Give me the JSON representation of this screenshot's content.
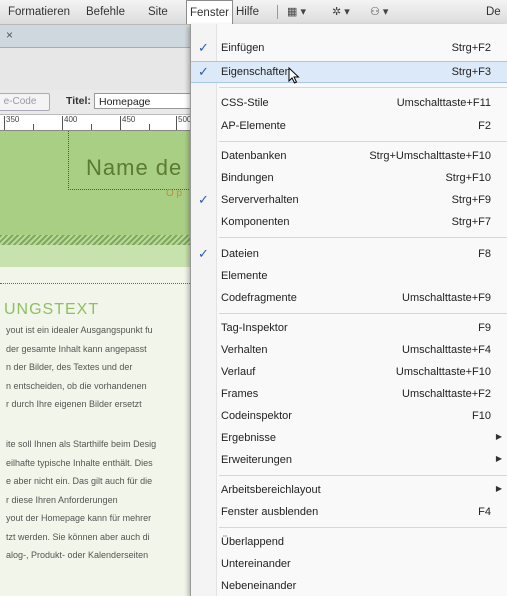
{
  "menubar": {
    "items": [
      "Formatieren",
      "Befehle",
      "Site",
      "Fenster",
      "Hilfe"
    ],
    "active": "Fenster",
    "right_label": "De"
  },
  "editor": {
    "close_glyph": "×",
    "code_button": "e-Code",
    "title_label": "Titel:",
    "title_value": "Homepage",
    "ruler_numbers": [
      "350",
      "400",
      "450",
      "500"
    ],
    "site_name": "Name de",
    "tagline": "O p",
    "heading": "UNGSTEXT",
    "body_lines_1": [
      "yout ist ein idealer Ausgangspunkt fu",
      "der gesamte Inhalt kann angepasst",
      "n der Bilder, des Textes und der",
      "n entscheiden, ob die vorhandenen",
      "r durch Ihre eigenen Bilder ersetzt"
    ],
    "body_lines_2": [
      "ite soll Ihnen als Starthilfe beim Desig",
      "eilhafte typische Inhalte enthält. Dies",
      "e aber nicht ein. Das gilt auch für die",
      "r diese Ihren Anforderungen",
      "yout der Homepage kann für mehrer",
      "tzt werden. Sie können aber auch di",
      "alog-, Produkt- oder Kalenderseiten"
    ]
  },
  "dropdown": {
    "items": [
      {
        "label": "Einfügen",
        "shortcut": "Strg+F2",
        "checked": true
      },
      {
        "label": "Eigenschaften",
        "shortcut": "Strg+F3",
        "checked": true,
        "highlighted": true
      },
      {
        "label": "CSS-Stile",
        "shortcut": "Umschalttaste+F11"
      },
      {
        "label": "AP-Elemente",
        "shortcut": "F2"
      },
      {
        "label": "Datenbanken",
        "shortcut": "Strg+Umschalttaste+F10"
      },
      {
        "label": "Bindungen",
        "shortcut": "Strg+F10"
      },
      {
        "label": "Serververhalten",
        "shortcut": "Strg+F9",
        "checked": true
      },
      {
        "label": "Komponenten",
        "shortcut": "Strg+F7"
      },
      {
        "label": "Dateien",
        "shortcut": "F8",
        "checked": true
      },
      {
        "label": "Elemente",
        "shortcut": ""
      },
      {
        "label": "Codefragmente",
        "shortcut": "Umschalttaste+F9"
      },
      {
        "label": "Tag-Inspektor",
        "shortcut": "F9"
      },
      {
        "label": "Verhalten",
        "shortcut": "Umschalttaste+F4"
      },
      {
        "label": "Verlauf",
        "shortcut": "Umschalttaste+F10"
      },
      {
        "label": "Frames",
        "shortcut": "Umschalttaste+F2"
      },
      {
        "label": "Codeinspektor",
        "shortcut": "F10"
      },
      {
        "label": "Ergebnisse",
        "shortcut": "",
        "submenu": true
      },
      {
        "label": "Erweiterungen",
        "shortcut": "",
        "submenu": true
      },
      {
        "label": "Arbeitsbereichlayout",
        "shortcut": "",
        "submenu": true
      },
      {
        "label": "Fenster ausblenden",
        "shortcut": "F4"
      },
      {
        "label": "Überlappend",
        "shortcut": ""
      },
      {
        "label": "Untereinander",
        "shortcut": ""
      },
      {
        "label": "Nebeneinander",
        "shortcut": ""
      }
    ]
  },
  "colors": {
    "highlight": "#dbe9f8",
    "checkmark": "#2a5db0",
    "header_green": "#a9cf85",
    "heading_green": "#8fbf63"
  }
}
